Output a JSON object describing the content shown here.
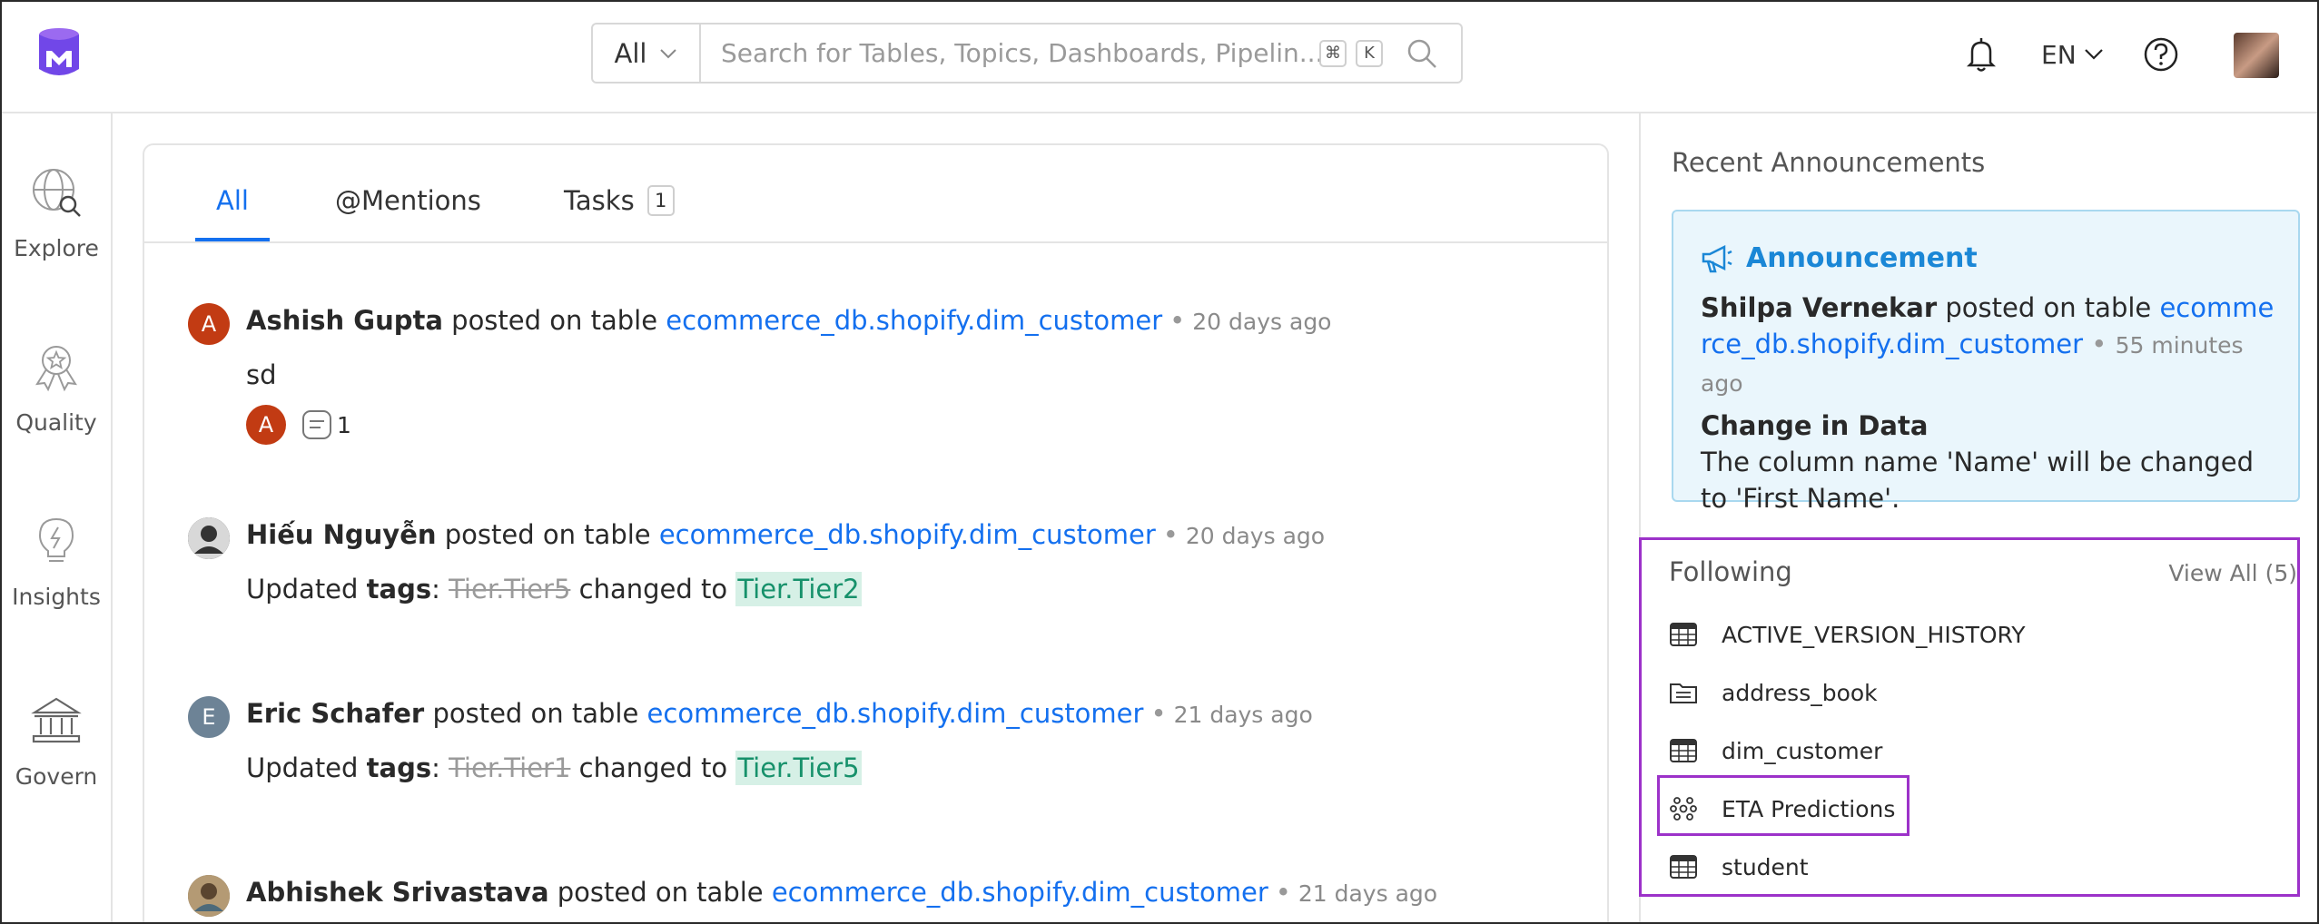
{
  "search": {
    "filter_label": "All",
    "placeholder": "Search for Tables, Topics, Dashboards, Pipelin...",
    "shortcut_cmd": "⌘",
    "shortcut_key": "K"
  },
  "header": {
    "language": "EN"
  },
  "sidebar": {
    "items": [
      {
        "label": "Explore",
        "icon": "globe-search-icon"
      },
      {
        "label": "Quality",
        "icon": "award-ribbon-icon"
      },
      {
        "label": "Insights",
        "icon": "lightbulb-icon"
      },
      {
        "label": "Govern",
        "icon": "institution-icon"
      }
    ]
  },
  "feed": {
    "tabs": [
      {
        "label": "All",
        "active": true
      },
      {
        "label": "@Mentions"
      },
      {
        "label": "Tasks",
        "count": "1"
      }
    ],
    "posts": [
      {
        "avatar_letter": "A",
        "avatar_color": "#c23b13",
        "author": "Ashish Gupta",
        "action": "posted on table",
        "entity": "ecommerce_db.shopify.dim_customer",
        "time": "20 days ago",
        "message": "sd",
        "reaction_letter": "A",
        "reply_count": "1"
      },
      {
        "avatar_letter": "",
        "avatar_color": "#2b2b2b",
        "author": "Hiếu Nguyễn",
        "action": "posted on table",
        "entity": "ecommerce_db.shopify.dim_customer",
        "time": "20 days ago",
        "update_prefix": "Updated",
        "update_field": "tags",
        "old_value": "Tier.Tier5",
        "changed_to": "changed to",
        "new_value": "Tier.Tier2"
      },
      {
        "avatar_letter": "E",
        "avatar_color": "#6d8396",
        "author": "Eric Schafer",
        "action": "posted on table",
        "entity": "ecommerce_db.shopify.dim_customer",
        "time": "21 days ago",
        "update_prefix": "Updated",
        "update_field": "tags",
        "old_value": "Tier.Tier1",
        "changed_to": "changed to",
        "new_value": "Tier.Tier5"
      },
      {
        "avatar_letter": "",
        "avatar_color": "#7b6a4e",
        "author": "Abhishek Srivastava",
        "action": "posted on table",
        "entity": "ecommerce_db.shopify.dim_customer",
        "time": "21 days ago"
      }
    ]
  },
  "announcements": {
    "section_title": "Recent Announcements",
    "label": "Announcement",
    "author": "Shilpa Vernekar",
    "action": "posted on table",
    "entity": "ecommerce_db.shopify.dim_customer",
    "time": "55 minutes ago",
    "title": "Change in Data",
    "body": "The column name 'Name' will be changed to 'First Name'."
  },
  "following": {
    "title": "Following",
    "view_all": "View All (5)",
    "items": [
      {
        "label": "ACTIVE_VERSION_HISTORY",
        "icon": "table-icon"
      },
      {
        "label": "address_book",
        "icon": "folder-icon"
      },
      {
        "label": "dim_customer",
        "icon": "table-icon"
      },
      {
        "label": "ETA Predictions",
        "icon": "ml-model-icon"
      },
      {
        "label": "student",
        "icon": "table-icon"
      }
    ]
  },
  "colors": {
    "accent": "#1470ef",
    "highlight_border": "#9c32c9",
    "announcement_bg": "#eaf6fc",
    "tag_new_bg": "#d6f0e6"
  }
}
